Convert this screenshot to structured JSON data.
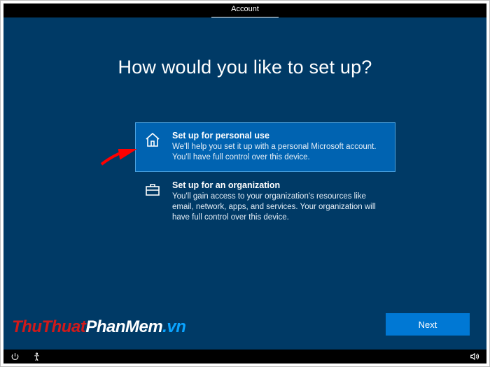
{
  "header": {
    "active_tab": "Account"
  },
  "main": {
    "heading": "How would you like to set up?",
    "options": [
      {
        "id": "personal",
        "title": "Set up for personal use",
        "description": "We'll help you set it up with a personal Microsoft account. You'll have full control over this device.",
        "selected": true,
        "icon": "home-icon"
      },
      {
        "id": "organization",
        "title": "Set up for an organization",
        "description": "You'll gain access to your organization's resources like email, network, apps, and services. Your organization will have full control over this device.",
        "selected": false,
        "icon": "briefcase-icon"
      }
    ],
    "next_label": "Next"
  },
  "watermark": {
    "part1": "ThuThuat",
    "part2": "PhanMem",
    "part3": ".vn"
  },
  "annotation": {
    "type": "red-arrow",
    "points_to": "personal"
  }
}
